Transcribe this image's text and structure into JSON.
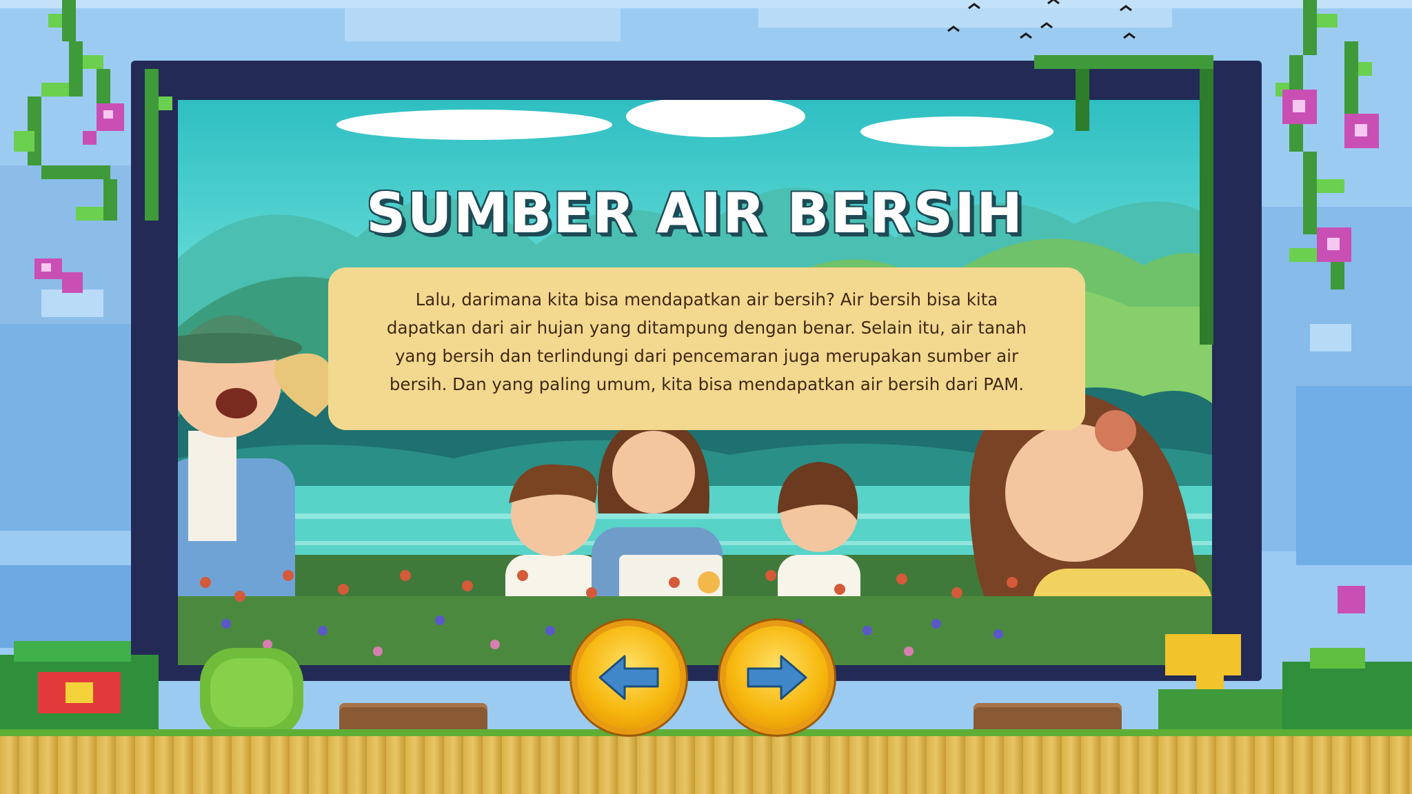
{
  "slide": {
    "title": "SUMBER AIR BERSIH",
    "lines": [
      "Lalu, darimana kita bisa mendapatkan air bersih? Air bersih bisa kita",
      "dapatkan dari air hujan yang ditampung dengan benar. Selain itu, air tanah",
      "yang bersih dan terlindungi dari pencemaran juga merupakan sumber air",
      "bersih. Dan yang paling umum, kita bisa mendapatkan air bersih dari PAM."
    ]
  },
  "navigation": {
    "prev_icon": "arrow-left-icon",
    "next_icon": "arrow-right-icon"
  },
  "colors": {
    "frame": "#222a55",
    "textbox": "#f3d88f",
    "button": "#f7b80f",
    "arrow": "#3f87c9",
    "title_shadow": "#1d4a55"
  }
}
